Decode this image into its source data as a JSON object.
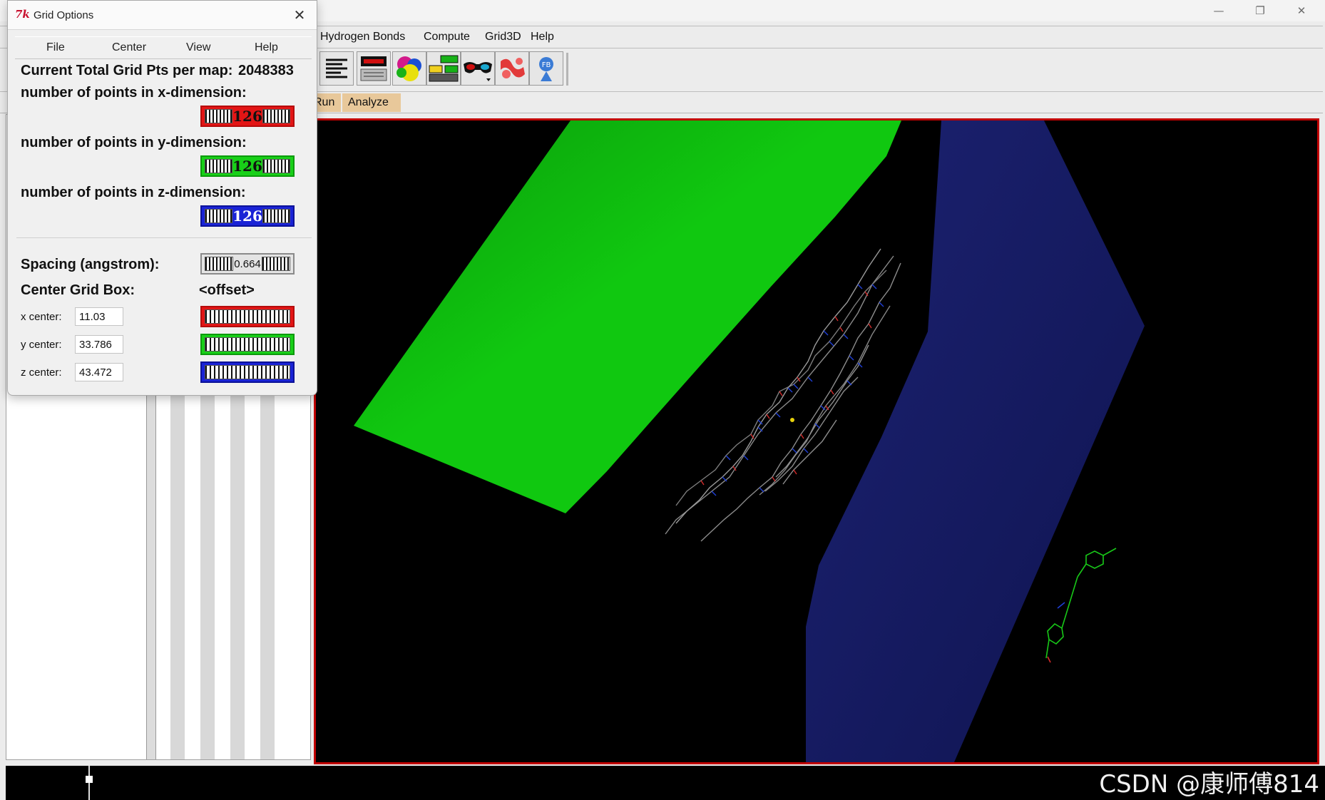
{
  "main_window": {
    "menu": [
      "Hydrogen Bonds",
      "Compute",
      "Grid3D",
      "Help"
    ],
    "tabs": [
      "Run",
      "Analyze"
    ],
    "toolbar_icons": [
      "align-text-icon",
      "display-panel-icon",
      "molecule-surface-icon",
      "network-icon",
      "stereo-glasses-icon",
      "ribbon-icon",
      "pmv-logo-icon"
    ],
    "window_controls": [
      "—",
      "❐",
      "✕"
    ]
  },
  "dialog": {
    "title": "Grid Options",
    "icon_text": "7k",
    "close_label": "✕",
    "menu": [
      "File",
      "Center",
      "View",
      "Help"
    ],
    "total_points_label": "Current Total Grid Pts per map:",
    "total_points_value": "2048383",
    "x_label": "number of points in x-dimension:",
    "y_label": "number of points in y-dimension:",
    "z_label": "number of points in z-dimension:",
    "x_points": "126",
    "y_points": "126",
    "z_points": "126",
    "spacing_label": "Spacing (angstrom):",
    "spacing_value": "0.664",
    "center_label": "Center Grid Box:",
    "offset_label": "<offset>",
    "x_center_label": "x center:",
    "y_center_label": "y center:",
    "z_center_label": "z center:",
    "x_center": "11.03",
    "y_center": "33.786",
    "z_center": "43.472",
    "colors": {
      "x": "#e31515",
      "y": "#18d018",
      "z": "#1a23d6"
    }
  },
  "viewer": {
    "background": "#000000",
    "border_color": "#c00000",
    "green_face_color": "#0fc80f",
    "blue_face_color": "#15196a"
  },
  "watermark": "CSDN @康师傅814"
}
